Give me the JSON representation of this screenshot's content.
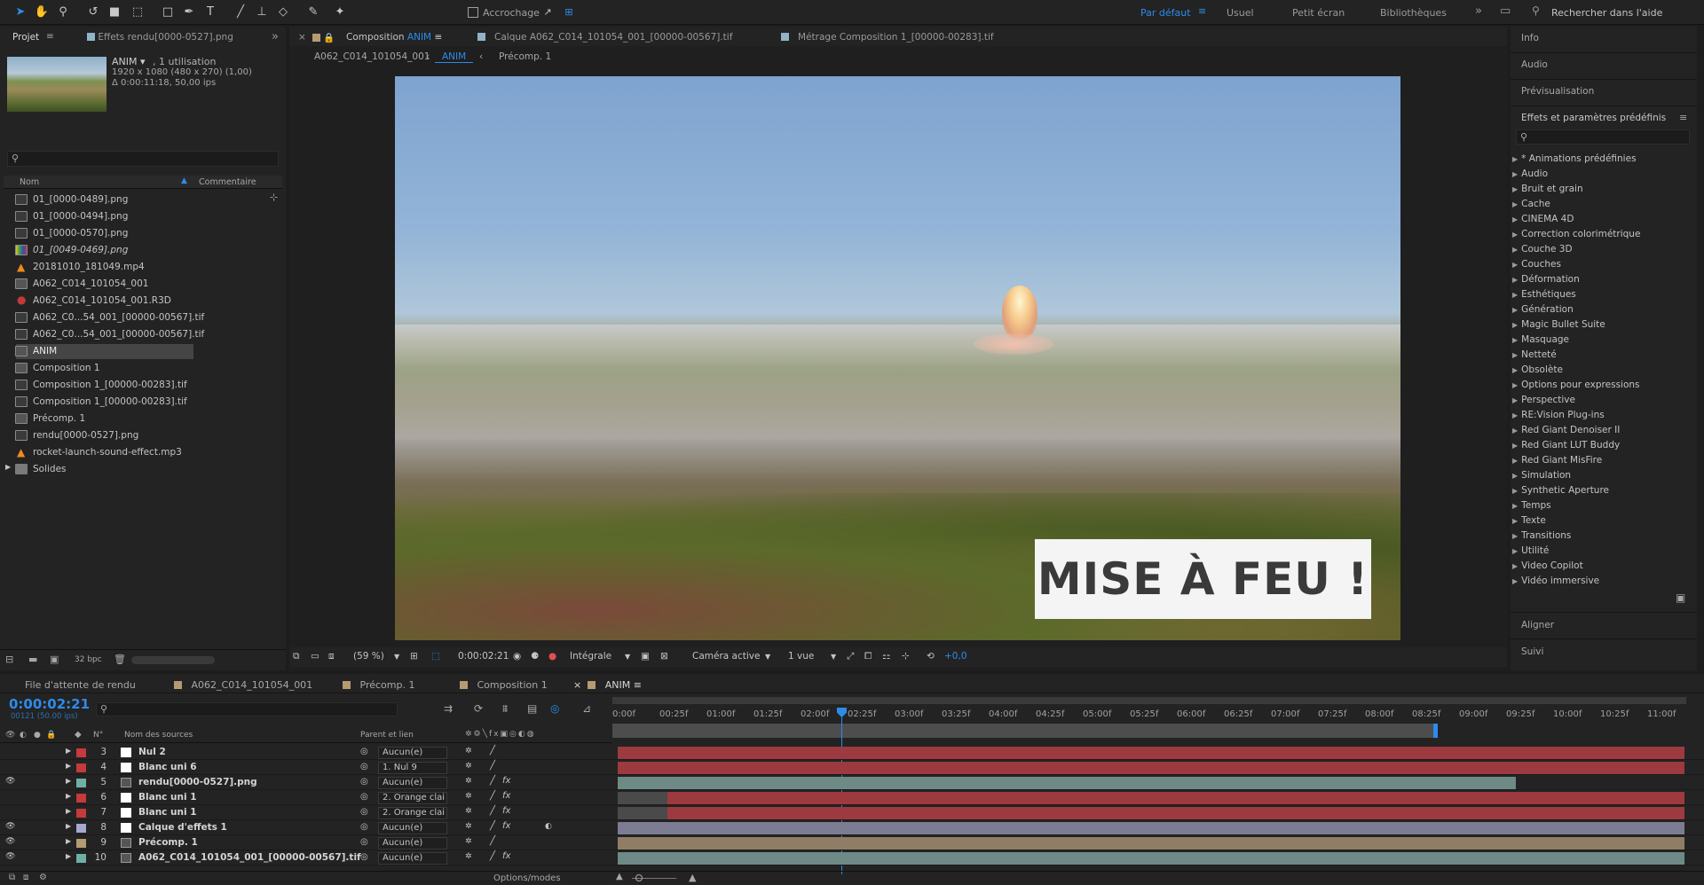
{
  "toolbar": {
    "snap_label": "Accrochage",
    "workspaces": [
      "Par défaut",
      "Usuel",
      "Petit écran",
      "Bibliothèques"
    ],
    "search_placeholder": "Rechercher dans l'aide"
  },
  "project": {
    "tab_label": "Projet",
    "effects_tab": "Effets rendu[0000-0527].png",
    "thumb_name": "ANIM ▾",
    "thumb_usage": ", 1 utilisation",
    "thumb_dims": "1920 x 1080 (480 x 270) (1,00)",
    "thumb_duration": "Δ 0:00:11:18, 50,00 ips",
    "col_name": "Nom",
    "col_comment": "Commentaire",
    "bpc": "32 bpc",
    "items": [
      {
        "name": "01_[0000-0489].png",
        "type": "img"
      },
      {
        "name": "01_[0000-0494].png",
        "type": "img"
      },
      {
        "name": "01_[0000-0570].png",
        "type": "img"
      },
      {
        "name": "01_[0049-0469].png",
        "type": "img-color"
      },
      {
        "name": "20181010_181049.mp4",
        "type": "vlc"
      },
      {
        "name": "A062_C014_101054_001",
        "type": "comp"
      },
      {
        "name": "A062_C014_101054_001.R3D",
        "type": "r3d"
      },
      {
        "name": "A062_C0...54_001_[00000-00567].tif",
        "type": "img"
      },
      {
        "name": "A062_C0...54_001_[00000-00567].tif",
        "type": "img"
      },
      {
        "name": "ANIM",
        "type": "comp",
        "selected": true
      },
      {
        "name": "Composition 1",
        "type": "comp"
      },
      {
        "name": "Composition 1_[00000-00283].tif",
        "type": "img"
      },
      {
        "name": "Composition 1_[00000-00283].tif",
        "type": "img"
      },
      {
        "name": "Précomp. 1",
        "type": "comp"
      },
      {
        "name": "rendu[0000-0527].png",
        "type": "img"
      },
      {
        "name": "rocket-launch-sound-effect.mp3",
        "type": "vlc"
      },
      {
        "name": "Solides",
        "type": "folder"
      }
    ]
  },
  "viewer": {
    "tabs": [
      "Composition ANIM",
      "Calque A062_C014_101054_001_[00000-00567].tif",
      "Métrage Composition 1_[00000-00283].tif"
    ],
    "comp_tab_prefix": "Composition",
    "comp_tab_name": "ANIM",
    "breadcrumbs": [
      "A062_C014_101054_001",
      "ANIM",
      "Précomp. 1"
    ],
    "overlay_text": "MISE À FEU !",
    "zoom": "(59 %)",
    "timecode": "0:00:02:21",
    "resolution": "Intégrale",
    "camera": "Caméra active",
    "views": "1 vue",
    "exposure": "+0,0"
  },
  "right_panels": {
    "top": [
      "Info",
      "Audio",
      "Prévisualisation"
    ],
    "effects_title": "Effets et paramètres prédéfinis",
    "effects": [
      "* Animations prédéfinies",
      "Audio",
      "Bruit et grain",
      "Cache",
      "CINEMA 4D",
      "Correction colorimétrique",
      "Couche 3D",
      "Couches",
      "Déformation",
      "Esthétiques",
      "Génération",
      "Magic Bullet Suite",
      "Masquage",
      "Netteté",
      "Obsolète",
      "Options pour expressions",
      "Perspective",
      "RE:Vision Plug-ins",
      "Red Giant Denoiser II",
      "Red Giant LUT Buddy",
      "Red Giant MisFire",
      "Simulation",
      "Synthetic Aperture",
      "Temps",
      "Texte",
      "Transitions",
      "Utilité",
      "Video Copilot",
      "Vidéo immersive"
    ],
    "bottom": [
      "Aligner",
      "Suivi"
    ]
  },
  "timeline": {
    "tabs": [
      "File d'attente de rendu",
      "A062_C014_101054_001",
      "Précomp. 1",
      "Composition 1",
      "ANIM"
    ],
    "timecode": "0:00:02:21",
    "frame_info": "00121 (50.00 ips)",
    "col_num": "N°",
    "col_source": "Nom des sources",
    "col_parent": "Parent et lien",
    "footer": "Options/modes",
    "ruler": [
      "0:00f",
      "00:25f",
      "01:00f",
      "01:25f",
      "02:00f",
      "02:25f",
      "03:00f",
      "03:25f",
      "04:00f",
      "04:25f",
      "05:00f",
      "05:25f",
      "06:00f",
      "06:25f",
      "07:00f",
      "07:25f",
      "08:00f",
      "08:25f",
      "09:00f",
      "09:25f",
      "10:00f",
      "10:25f",
      "11:00f"
    ],
    "layers": [
      {
        "num": "3",
        "name": "Nul 2",
        "label": "#c53a3a",
        "parent": "Aucun(e)",
        "icon": "white",
        "fx": false
      },
      {
        "num": "4",
        "name": "Blanc uni 6",
        "label": "#c53a3a",
        "parent": "1. Nul 9",
        "icon": "white",
        "fx": false
      },
      {
        "num": "5",
        "name": "rendu[0000-0527].png",
        "label": "#6fb0a6",
        "parent": "Aucun(e)",
        "icon": "img",
        "fx": true
      },
      {
        "num": "6",
        "name": "Blanc uni 1",
        "label": "#c53a3a",
        "parent": "2. Orange clai",
        "icon": "white",
        "fx": true
      },
      {
        "num": "7",
        "name": "Blanc uni 1",
        "label": "#c53a3a",
        "parent": "2. Orange clai",
        "icon": "white",
        "fx": true
      },
      {
        "num": "8",
        "name": "Calque d'effets 1",
        "label": "#a7a7d0",
        "parent": "Aucun(e)",
        "icon": "white",
        "fx": true
      },
      {
        "num": "9",
        "name": "Précomp. 1",
        "label": "#b59a73",
        "parent": "Aucun(e)",
        "icon": "comp",
        "fx": false
      },
      {
        "num": "10",
        "name": "A062_C014_101054_001_[00000-00567].tif",
        "label": "#6fb0a6",
        "parent": "Aucun(e)",
        "icon": "img",
        "fx": true
      }
    ]
  },
  "colors": {
    "accent": "#2d8ceb",
    "red_bar": "#9d3a40",
    "teal_bar": "#6e8a87",
    "lavender_bar": "#7c7c92",
    "tan_bar": "#8f7d66"
  }
}
